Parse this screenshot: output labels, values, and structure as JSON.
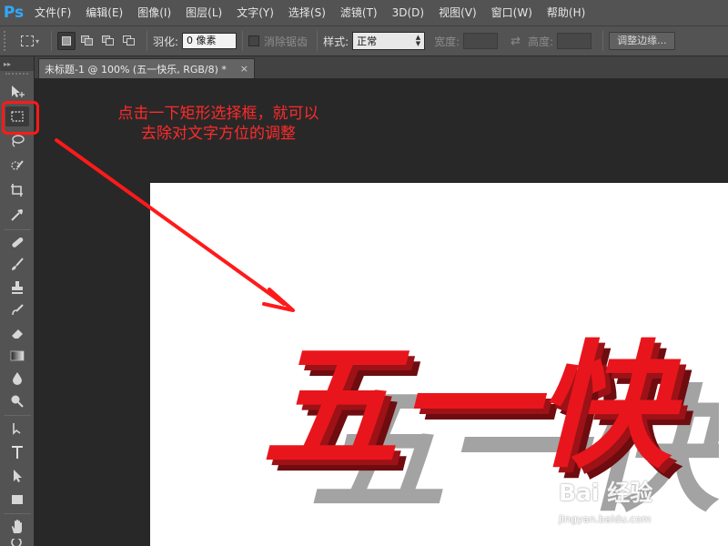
{
  "app": {
    "logo": "Ps",
    "brand_color": "#31a8ff"
  },
  "menubar": {
    "items": [
      {
        "label": "文件(F)"
      },
      {
        "label": "编辑(E)"
      },
      {
        "label": "图像(I)"
      },
      {
        "label": "图层(L)"
      },
      {
        "label": "文字(Y)"
      },
      {
        "label": "选择(S)"
      },
      {
        "label": "滤镜(T)"
      },
      {
        "label": "3D(D)"
      },
      {
        "label": "视图(V)"
      },
      {
        "label": "窗口(W)"
      },
      {
        "label": "帮助(H)"
      }
    ]
  },
  "options": {
    "feather_label": "羽化:",
    "feather_value": "0 像素",
    "antialias_label": "消除锯齿",
    "style_label": "样式:",
    "style_value": "正常",
    "width_label": "宽度:",
    "height_label": "高度:",
    "adjust_edge_label": "调整边缘..."
  },
  "document": {
    "tab_title": "未标题-1 @ 100% (五一快乐, RGB/8) *",
    "close_symbol": "×",
    "text_layer": "五一快"
  },
  "annotation": {
    "line1": "点击一下矩形选择框，就可以",
    "line2": "去除对文字方位的调整",
    "color": "#ff1a1a"
  },
  "watermark": {
    "logo": "Bai 经验",
    "url": "jingyan.baidu.com"
  },
  "toolbox": {
    "collapse": "▸▸",
    "active_tool": "rectangular-marquee"
  }
}
